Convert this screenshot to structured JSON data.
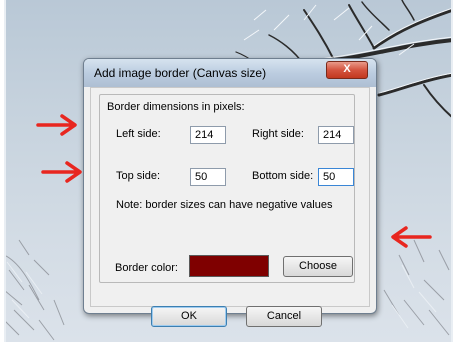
{
  "dialog": {
    "title": "Add image border (Canvas size)",
    "close_glyph": "X",
    "group_heading": "Border dimensions in pixels:",
    "left_label": "Left side:",
    "left_value": "214",
    "right_label": "Right side:",
    "right_value": "214",
    "top_label": "Top side:",
    "top_value": "50",
    "bottom_label": "Bottom side:",
    "bottom_value": "50",
    "note": "Note: border sizes can have negative values",
    "color_label": "Border color:",
    "border_color": "#7f0000",
    "choose_label": "Choose",
    "ok_label": "OK",
    "cancel_label": "Cancel"
  },
  "annotations": {
    "arrow_color": "#e8261f",
    "arrow_icon": "right-arrow-icon / left-arrow-icon"
  }
}
